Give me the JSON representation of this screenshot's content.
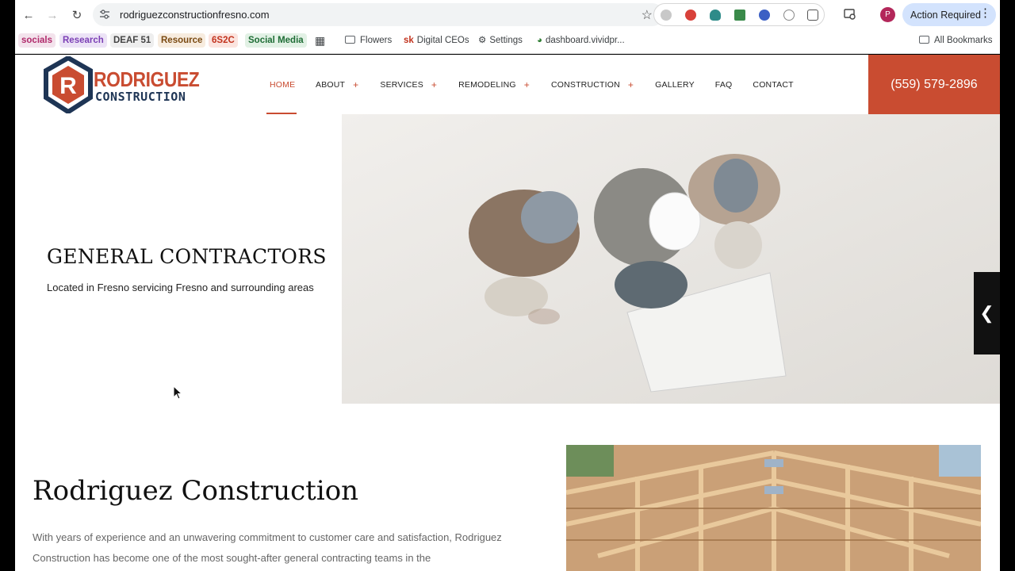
{
  "browser": {
    "url": "rodriguezconstructionfresno.com",
    "profile_initial": "P",
    "action_button": "Action Required",
    "bookmarks": [
      {
        "label": "socials",
        "color": "#b02a6b",
        "bg": "#f3e3ec",
        "chip": true
      },
      {
        "label": "Research",
        "color": "#7b3fb5",
        "bg": "#ece3f6",
        "chip": true
      },
      {
        "label": "DEAF 51",
        "color": "#444444",
        "bg": "#eeeeee",
        "chip": true
      },
      {
        "label": "Resource",
        "color": "#7a4a12",
        "bg": "#f7ecdf",
        "chip": true
      },
      {
        "label": "6S2C",
        "color": "#c2331e",
        "bg": "#fbe4df",
        "chip": true
      },
      {
        "label": "Social Media",
        "color": "#1f6d36",
        "bg": "#e2f1e5",
        "chip": true
      }
    ],
    "bookmark_links": [
      "Flowers",
      "Digital CEOs",
      "Settings",
      "dashboard.vividpr..."
    ],
    "all_bookmarks": "All Bookmarks"
  },
  "site": {
    "logo_line1": "RODRIGUEZ",
    "logo_line2": "CONSTRUCTION",
    "nav": [
      {
        "label": "HOME",
        "plus": false,
        "active": true
      },
      {
        "label": "ABOUT",
        "plus": true
      },
      {
        "label": "SERVICES",
        "plus": true
      },
      {
        "label": "REMODELING",
        "plus": true
      },
      {
        "label": "CONSTRUCTION",
        "plus": true
      },
      {
        "label": "GALLERY",
        "plus": false
      },
      {
        "label": "FAQ",
        "plus": false
      },
      {
        "label": "CONTACT",
        "plus": false
      }
    ],
    "plus_symbol": "+",
    "phone": "(559) 579-2896",
    "hero_title": "GENERAL CONTRACTORS",
    "hero_subtitle": "Located in Fresno servicing Fresno and surrounding areas",
    "about_title": "Rodriguez Construction",
    "about_body": "With years of experience and an unwavering commitment to customer care and satisfaction, Rodriguez Construction has become one of the most sought-after general contracting teams in the",
    "brand_color": "#c94c31",
    "navy_color": "#1e3555"
  }
}
